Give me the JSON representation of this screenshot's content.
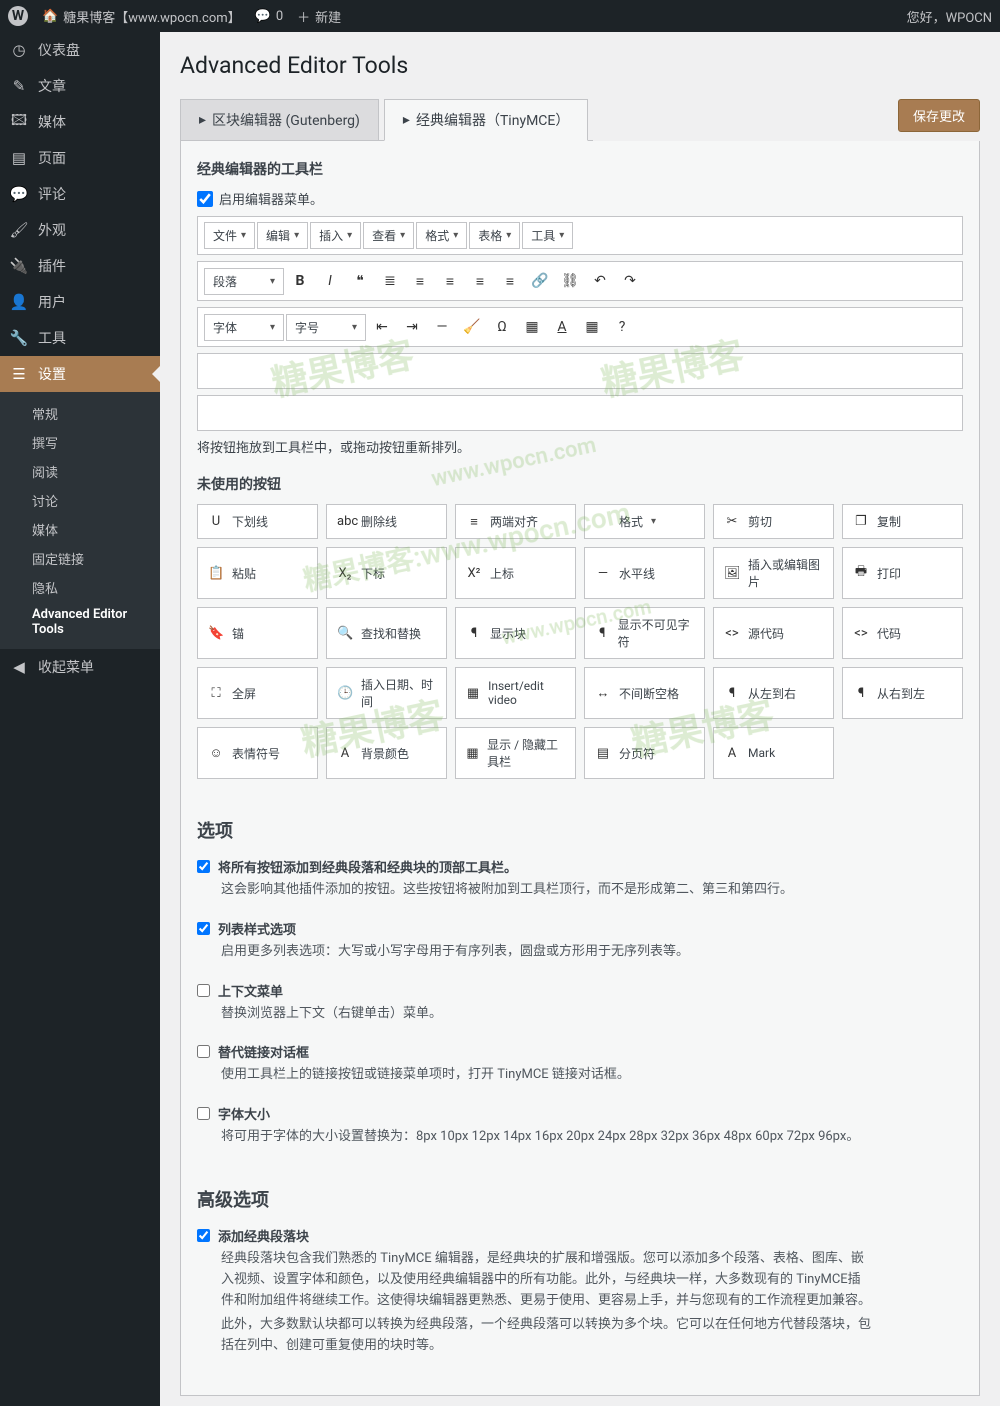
{
  "toolbar": {
    "site_name": "糖果博客【www.wpocn.com】",
    "comments": "0",
    "new": "新建",
    "greeting": "您好，WPOCN"
  },
  "sidebar": {
    "items": [
      {
        "icon": "◷",
        "label": "仪表盘"
      },
      {
        "icon": "✎",
        "label": "文章"
      },
      {
        "icon": "🖾",
        "label": "媒体"
      },
      {
        "icon": "▤",
        "label": "页面"
      },
      {
        "icon": "💬",
        "label": "评论"
      },
      {
        "icon": "🖌",
        "label": "外观"
      },
      {
        "icon": "🔌",
        "label": "插件"
      },
      {
        "icon": "👤",
        "label": "用户"
      },
      {
        "icon": "🔧",
        "label": "工具"
      },
      {
        "icon": "☰",
        "label": "设置"
      }
    ],
    "submenu": [
      "常规",
      "撰写",
      "阅读",
      "讨论",
      "媒体",
      "固定链接",
      "隐私",
      "Advanced Editor Tools"
    ],
    "collapse": "收起菜单"
  },
  "page": {
    "title": "Advanced Editor Tools",
    "tabs": [
      "区块编辑器 (Gutenberg)",
      "经典编辑器（TinyMCE）"
    ],
    "save": "保存更改",
    "toolbar_heading": "经典编辑器的工具栏",
    "enable_menu": "启用编辑器菜单。",
    "menu_items": [
      "文件",
      "编辑",
      "插入",
      "查看",
      "格式",
      "表格",
      "工具"
    ],
    "para_dd": "段落",
    "font_dd": "字体",
    "size_dd": "字号",
    "row2_icons": [
      "bold",
      "italic",
      "quote",
      "ul",
      "ol",
      "align-left",
      "align-center",
      "align-right",
      "link",
      "unlink",
      "undo",
      "redo"
    ],
    "row3_icons": [
      "outdent",
      "indent",
      "hr",
      "clear-fmt",
      "omega",
      "table",
      "text-color",
      "table2",
      "help"
    ],
    "drag_help": "将按钮拖放到工具栏中，或拖动按钮重新排列。",
    "unused_heading": "未使用的按钮",
    "unused": [
      {
        "ic": "U",
        "label": "下划线"
      },
      {
        "ic": "abc",
        "label": "删除线"
      },
      {
        "ic": "≡",
        "label": "两端对齐"
      },
      {
        "ic": "",
        "label": "格式",
        "dd": true
      },
      {
        "ic": "✂",
        "label": "剪切"
      },
      {
        "ic": "❐",
        "label": "复制"
      },
      {
        "ic": "📋",
        "label": "粘贴"
      },
      {
        "ic": "X₂",
        "label": "下标"
      },
      {
        "ic": "X²",
        "label": "上标"
      },
      {
        "ic": "—",
        "label": "水平线"
      },
      {
        "ic": "🖼",
        "label": "插入或编辑图片"
      },
      {
        "ic": "🖶",
        "label": "打印"
      },
      {
        "ic": "🔖",
        "label": "锚"
      },
      {
        "ic": "🔍",
        "label": "查找和替换"
      },
      {
        "ic": "¶",
        "label": "显示块"
      },
      {
        "ic": "¶",
        "label": "显示不可见字符"
      },
      {
        "ic": "<>",
        "label": "源代码"
      },
      {
        "ic": "<>",
        "label": "代码"
      },
      {
        "ic": "⛶",
        "label": "全屏"
      },
      {
        "ic": "🕒",
        "label": "插入日期、时间"
      },
      {
        "ic": "▦",
        "label": "Insert/edit video"
      },
      {
        "ic": "↔",
        "label": "不间断空格"
      },
      {
        "ic": "¶",
        "label": "从左到右"
      },
      {
        "ic": "¶",
        "label": "从右到左"
      },
      {
        "ic": "☺",
        "label": "表情符号"
      },
      {
        "ic": "A",
        "label": "背景颜色"
      },
      {
        "ic": "▦",
        "label": "显示 / 隐藏工具栏"
      },
      {
        "ic": "▤",
        "label": "分页符"
      },
      {
        "ic": "A",
        "label": "Mark"
      }
    ],
    "options_heading": "选项",
    "options": [
      {
        "checked": true,
        "title": "将所有按钮添加到经典段落和经典块的顶部工具栏。",
        "desc": "这会影响其他插件添加的按钮。这些按钮将被附加到工具栏顶行，而不是形成第二、第三和第四行。"
      },
      {
        "checked": true,
        "title": "列表样式选项",
        "desc": "启用更多列表选项：大写或小写字母用于有序列表，圆盘或方形用于无序列表等。"
      },
      {
        "checked": false,
        "title": "上下文菜单",
        "desc": "替换浏览器上下文（右键单击）菜单。"
      },
      {
        "checked": false,
        "title": "替代链接对话框",
        "desc": "使用工具栏上的链接按钮或链接菜单项时，打开 TinyMCE 链接对话框。"
      },
      {
        "checked": false,
        "title": "字体大小",
        "desc": "将可用于字体的大小设置替换为：8px 10px 12px 14px 16px 20px 24px 28px 32px 36px 48px 60px 72px 96px。"
      }
    ],
    "adv_heading": "高级选项",
    "adv": [
      {
        "checked": true,
        "title": "添加经典段落块",
        "desc": "经典段落块包含我们熟悉的 TinyMCE 编辑器，是经典块的扩展和增强版。您可以添加多个段落、表格、图库、嵌入视频、设置字体和颜色，以及使用经典编辑器中的所有功能。此外，与经典块一样，大多数现有的 TinyMCE插件和附加组件将继续工作。这使得块编辑器更熟悉、更易于使用、更容易上手，并与您现有的工作流程更加兼容。",
        "desc2": "此外，大多数默认块都可以转换为经典段落，一个经典段落可以转换为多个块。它可以在任何地方代替段落块，包括在列中、创建可重复使用的块时等。"
      }
    ]
  },
  "watermarks": [
    "糖果博客",
    "糖果博客",
    "www.wpocn.com",
    "糖果博客:www.wpocn.com",
    "www.wpocn.com",
    "糖果博客"
  ]
}
